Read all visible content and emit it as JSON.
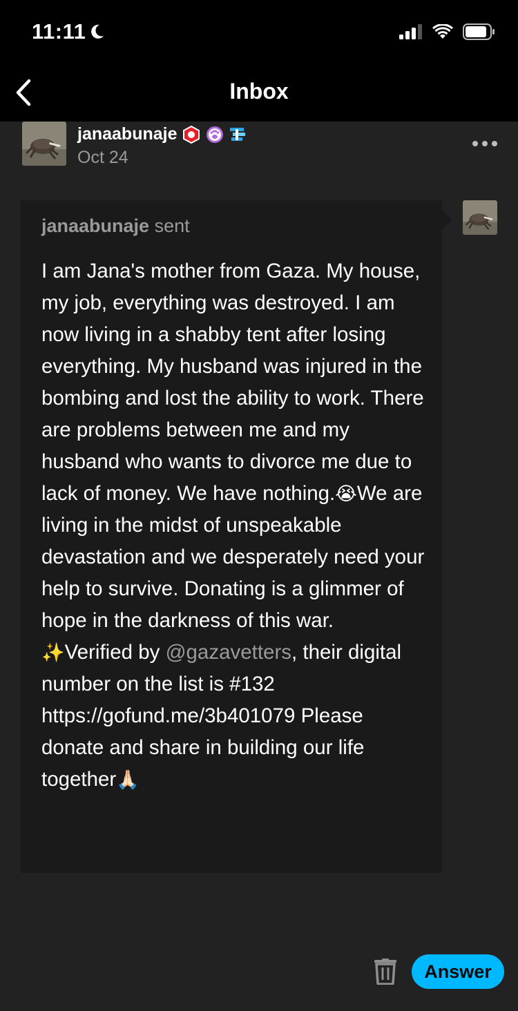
{
  "status_bar": {
    "time": "11:11",
    "icons": [
      "moon-icon",
      "signal-icon",
      "wifi-icon",
      "battery-icon"
    ]
  },
  "nav": {
    "title": "Inbox",
    "back_icon": "chevron-left-icon"
  },
  "post": {
    "username": "janaabunaje",
    "date": "Oct 24",
    "badges": [
      "red-hexagon-badge",
      "paw-badge",
      "blue-streak-badge"
    ],
    "more_icon": "ellipsis-icon"
  },
  "message": {
    "sender": "janaabunaje",
    "sent_word": "sent",
    "body_part1": "I am Jana's mother from Gaza. My house, my job, everything was destroyed. I am now living in a shabby tent after losing everything. My husband was injured in the bombing and lost the ability to work. There are problems between me and my husband who wants to divorce me due to lack of money. We have nothing.",
    "emoji_crying": "😭",
    "body_part2": "We are living in the midst of unspeakable devastation and we desperately need your help to survive. Donating is a glimmer of hope in the darkness of this war.",
    "emoji_sparkles": "✨",
    "body_part3": "Verified by ",
    "mention": "@gazavetters",
    "body_part4": ", their digital number on the list is #132 https://gofund.me/3b401079 Please donate and share in building our life together",
    "emoji_pray": "🙏🏻"
  },
  "actions": {
    "trash_icon": "trash-icon",
    "answer_label": "Answer"
  },
  "colors": {
    "background": "#222222",
    "bubble": "#1a1a1a",
    "accent": "#00b8ff",
    "muted_text": "#9a9a9a"
  }
}
